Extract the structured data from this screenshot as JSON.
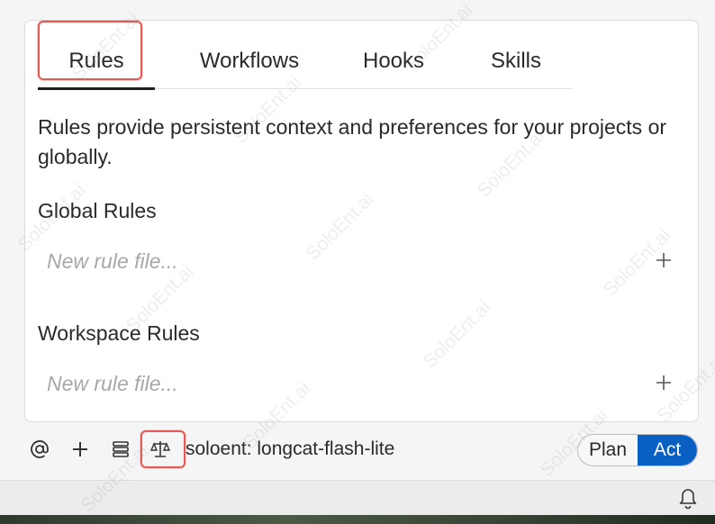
{
  "tabs": [
    {
      "label": "Rules",
      "active": true
    },
    {
      "label": "Workflows",
      "active": false
    },
    {
      "label": "Hooks",
      "active": false
    },
    {
      "label": "Skills",
      "active": false
    }
  ],
  "description": "Rules provide persistent context and preferences for your projects or globally.",
  "global_rules": {
    "title": "Global Rules",
    "placeholder": "New rule file..."
  },
  "workspace_rules": {
    "title": "Workspace Rules",
    "placeholder": "New rule file..."
  },
  "toolbar": {
    "mention_icon": "at-icon",
    "add_icon": "plus-icon",
    "server_icon": "server-icon",
    "rules_icon": "scale-icon",
    "model_label": "soloent: longcat-flash-lite"
  },
  "mode_toggle": {
    "plan_label": "Plan",
    "act_label": "Act",
    "selected": "Act"
  },
  "watermark": "SoloEnt.ai",
  "colors": {
    "accent": "#0a5fc2",
    "highlight": "#e55a55"
  }
}
